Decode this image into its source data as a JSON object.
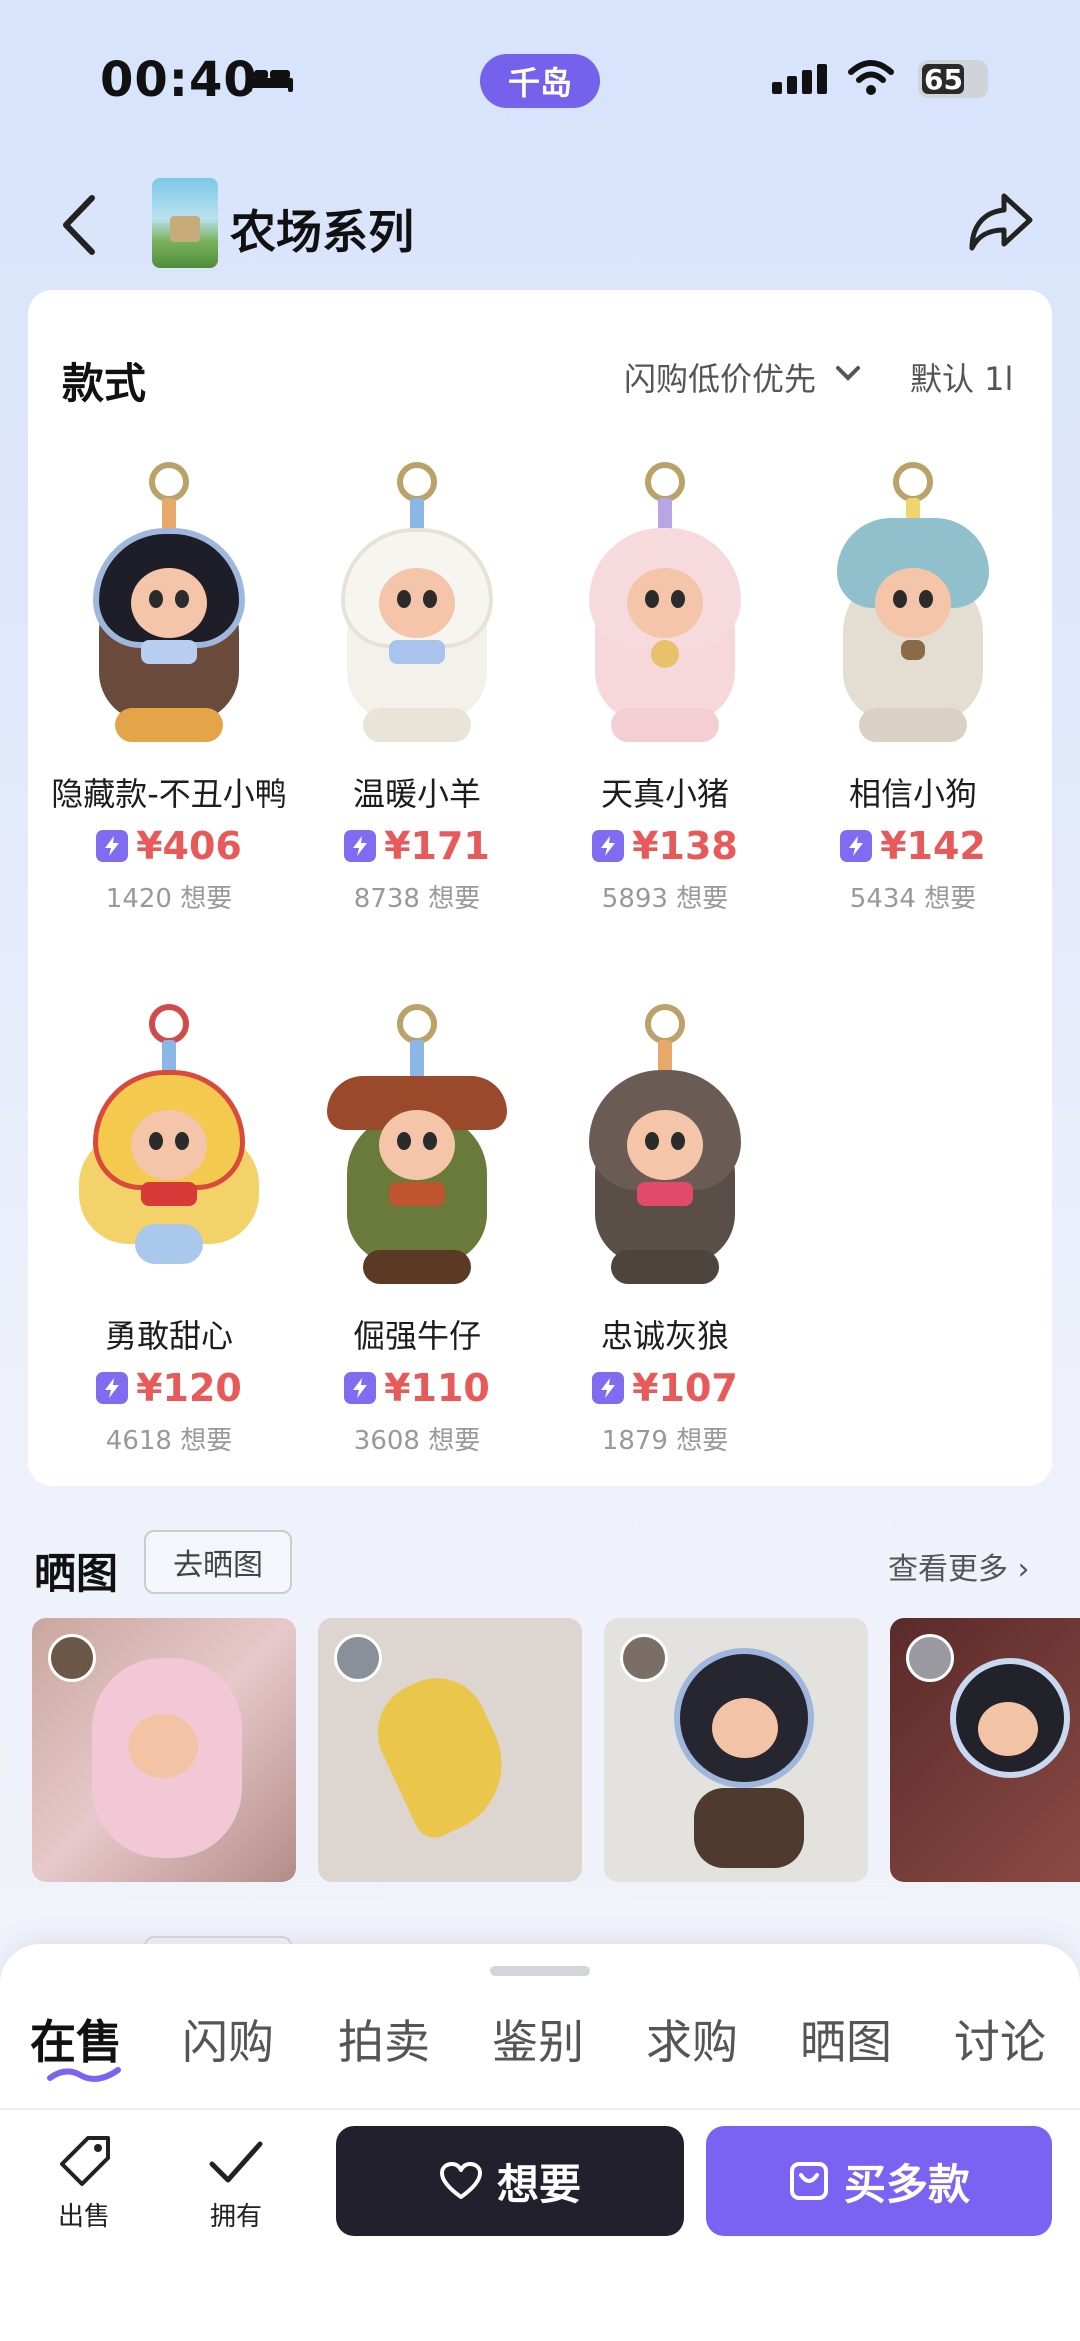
{
  "status_bar": {
    "time": "00:40",
    "app_pill": "千岛",
    "battery": "65"
  },
  "header": {
    "title": "农场系列"
  },
  "styles": {
    "title": "款式",
    "sort_pref": "闪购低价优先",
    "sort_default": "默认 1l",
    "items": [
      {
        "name": "隐藏款-不丑小鸭",
        "price": "¥406",
        "want": "1420 想要"
      },
      {
        "name": "温暖小羊",
        "price": "¥171",
        "want": "8738 想要"
      },
      {
        "name": "天真小猪",
        "price": "¥138",
        "want": "5893 想要"
      },
      {
        "name": "相信小狗",
        "price": "¥142",
        "want": "5434 想要"
      },
      {
        "name": "勇敢甜心",
        "price": "¥120",
        "want": "4618 想要"
      },
      {
        "name": "倔强牛仔",
        "price": "¥110",
        "want": "3608 想要"
      },
      {
        "name": "忠诚灰狼",
        "price": "¥107",
        "want": "1879 想要"
      }
    ]
  },
  "photos_section": {
    "title": "晒图",
    "post_button": "去晒图",
    "see_more": "查看更多 ›"
  },
  "tabs": [
    "在售",
    "闪购",
    "拍卖",
    "鉴别",
    "求购",
    "晒图",
    "讨论"
  ],
  "active_tab": "在售",
  "bottom_bar": {
    "sell": "出售",
    "own": "拥有",
    "want": "想要",
    "buy_multi": "买多款"
  },
  "colors": {
    "accent": "#7a63f2",
    "price": "#e85a5a",
    "dark_button": "#23202e"
  }
}
